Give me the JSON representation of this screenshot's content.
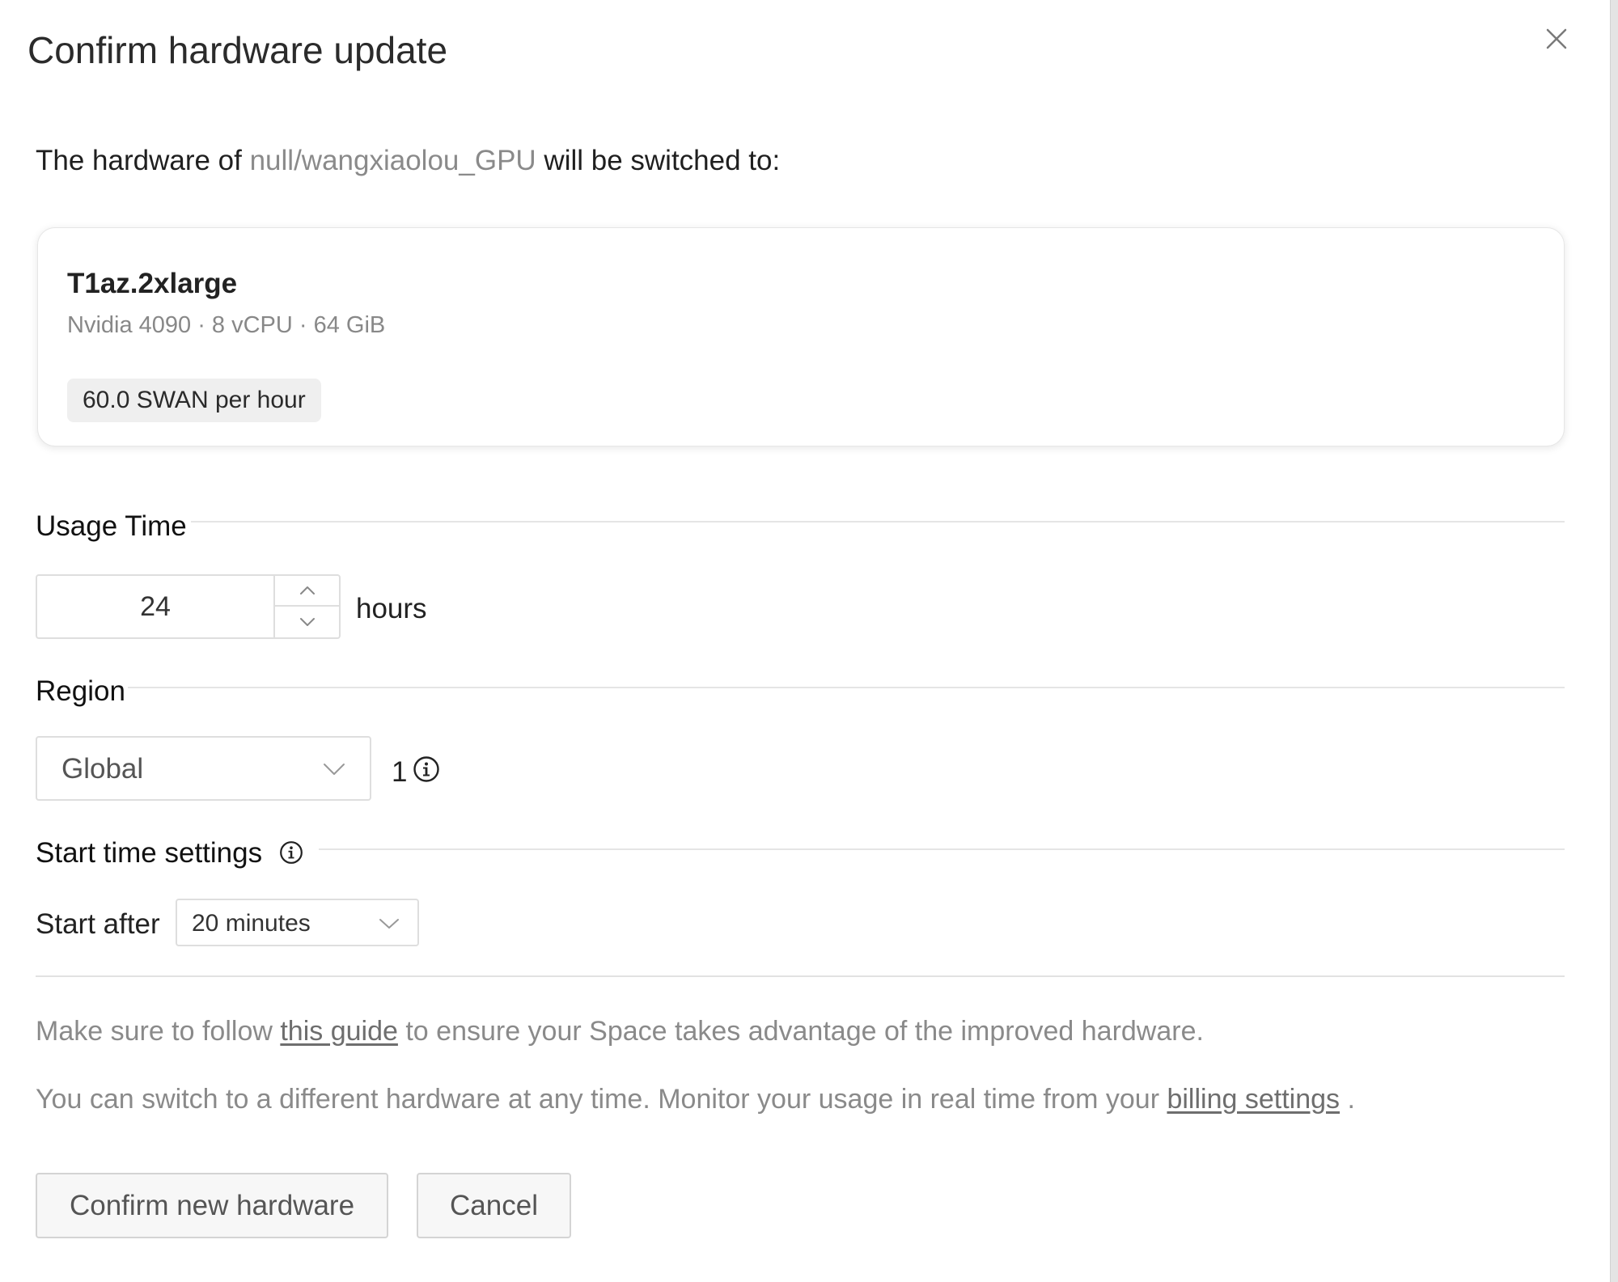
{
  "dialog": {
    "title": "Confirm hardware update",
    "close_icon": "close-icon"
  },
  "intro": {
    "prefix": "The hardware of ",
    "space_name": "null/wangxiaolou_GPU",
    "suffix": " will be switched to:"
  },
  "hardware": {
    "name": "T1az.2xlarge",
    "specs": "Nvidia 4090 · 8 vCPU · 64 GiB",
    "price": "60.0 SWAN per hour"
  },
  "usage_time": {
    "heading": "Usage Time",
    "value": "24",
    "unit": "hours",
    "up_icon": "chevron-up-icon",
    "down_icon": "chevron-down-icon"
  },
  "region": {
    "heading": "Region",
    "selected": "Global",
    "count": "1",
    "info_icon": "info-icon"
  },
  "start_time": {
    "heading": "Start time settings",
    "info_icon": "info-icon",
    "label": "Start after",
    "selected": "20 minutes"
  },
  "notes": {
    "guide_prefix": "Make sure to follow ",
    "guide_link": "this guide",
    "guide_suffix": " to ensure your Space takes advantage of the improved hardware.",
    "billing_prefix": "You can switch to a different hardware at any time. Monitor your usage in real time from your ",
    "billing_link": "billing settings",
    "billing_suffix": " ."
  },
  "actions": {
    "confirm_label": "Confirm new hardware",
    "cancel_label": "Cancel"
  },
  "colors": {
    "muted_text": "#8a8a8a",
    "border": "#dedede",
    "button_bg": "#f7f7f7"
  }
}
